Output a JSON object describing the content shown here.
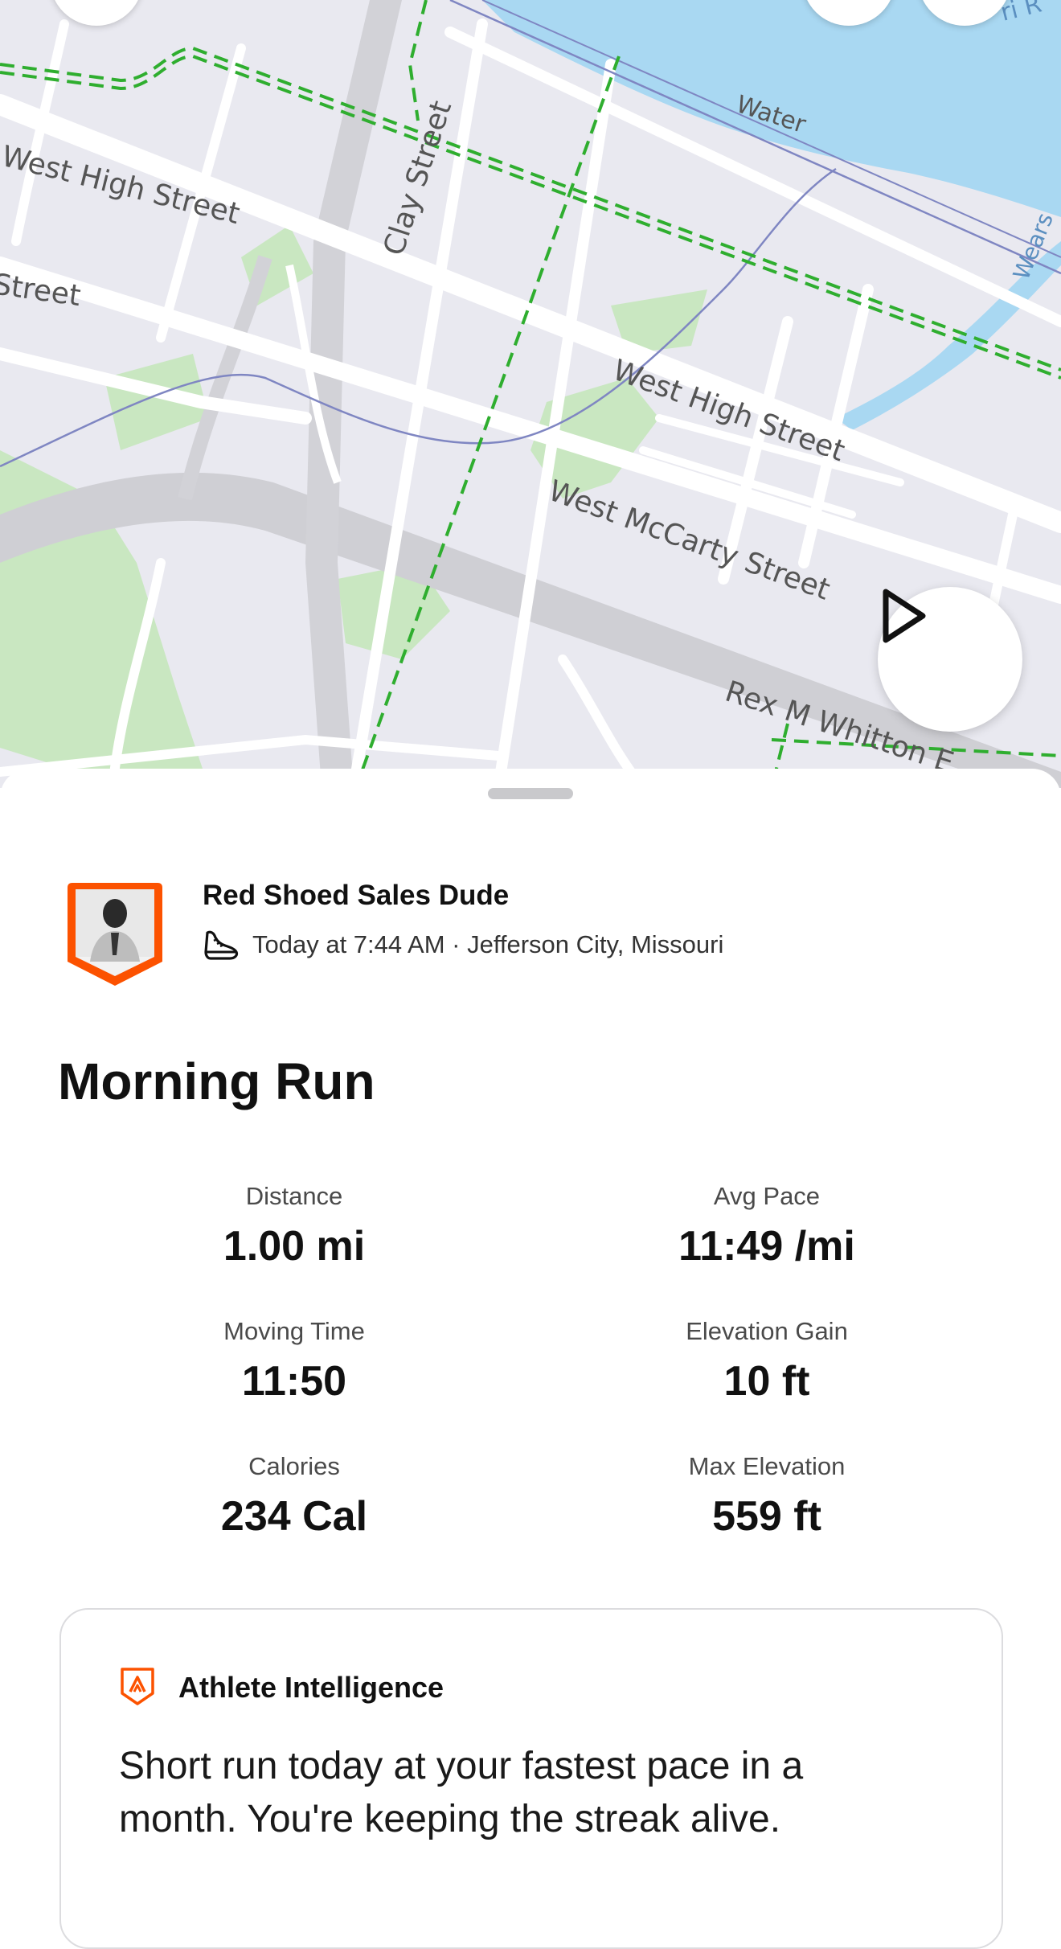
{
  "map": {
    "street_labels": {
      "west_high_street_left": "West High Street",
      "street_left": "Street",
      "clay_street": "Clay Street",
      "water": "Water",
      "west_high_street_right": "West High Street",
      "west_mccarty_street": "West McCarty Street",
      "rex_m_whitton": "Rex M Whitton E",
      "river_label": "ri R",
      "wears_label": "Wears"
    },
    "colors": {
      "land": "#e9e9f0",
      "water": "#a9d8f2",
      "park": "#c9e7c1",
      "road": "#ffffff",
      "highway": "#cfcfd4",
      "trail": "#2fae2f",
      "rail": "#7f86c2"
    }
  },
  "activity": {
    "athlete_name": "Red Shoed Sales Dude",
    "meta": "Today at 7:44 AM · Jefferson City, Missouri",
    "sport_icon": "running-shoe-icon",
    "title": "Morning Run"
  },
  "stats": [
    {
      "label": "Distance",
      "value": "1.00 mi"
    },
    {
      "label": "Avg Pace",
      "value": "11:49 /mi"
    },
    {
      "label": "Moving Time",
      "value": "11:50"
    },
    {
      "label": "Elevation Gain",
      "value": "10 ft"
    },
    {
      "label": "Calories",
      "value": "234 Cal"
    },
    {
      "label": "Max Elevation",
      "value": "559 ft"
    }
  ],
  "athlete_intelligence": {
    "title": "Athlete Intelligence",
    "text": "Short run today at your fastest pace in a month. You're keeping the streak alive.",
    "accent": "#fc5200"
  }
}
